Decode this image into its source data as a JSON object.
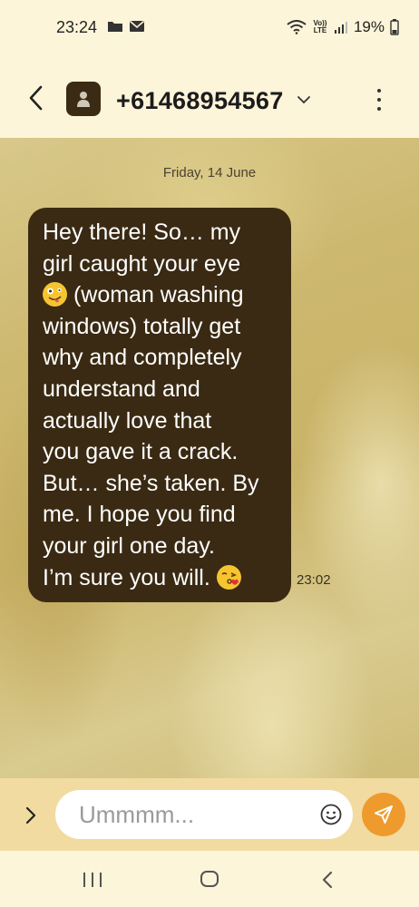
{
  "status_bar": {
    "time": "23:24",
    "network_label": "Vo)) LTE",
    "battery_percent": "19%"
  },
  "header": {
    "contact": "+61468954567"
  },
  "conversation": {
    "date": "Friday, 14 June",
    "message_lines": [
      "Hey there! So… my",
      "girl caught your eye",
      " (woman washing",
      "windows) totally get",
      "why and completely",
      "understand and",
      "actually love that",
      "you gave it a crack.",
      "But… she’s taken. By",
      "me. I hope you find",
      "your girl one day.",
      "I’m sure you will. "
    ],
    "message_time": "23:02",
    "emojis": [
      "zany-face-emoji",
      "face-blowing-kiss-emoji"
    ]
  },
  "composer": {
    "value": "Ummmm..."
  },
  "colors": {
    "bubble": "#3a2a13",
    "send_button": "#ef9a2c",
    "app_bar": "#fdf5d9",
    "composer_bar": "#f1dba0"
  }
}
